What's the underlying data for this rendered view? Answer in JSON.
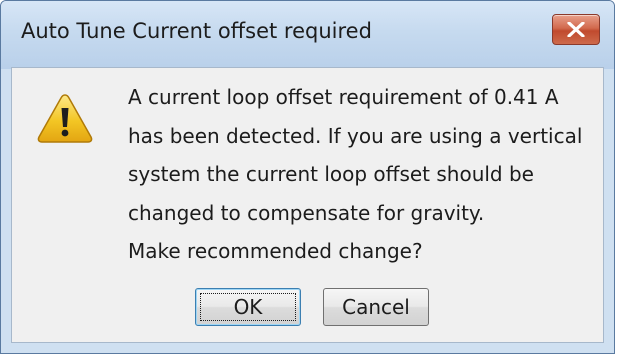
{
  "dialog": {
    "title": "Auto Tune Current offset required",
    "close_icon": "close-x-icon",
    "icon": "warning-icon",
    "message_lines": [
      "A current loop offset requirement of 0.41 A",
      "has been detected.  If you are using a vertical",
      "system the current loop offset should be",
      "changed to compensate for gravity.",
      "Make recommended change?"
    ],
    "ok_label": "OK",
    "cancel_label": "Cancel"
  },
  "colors": {
    "close_button": "#c75a3d",
    "warning_fill": "#f3c624",
    "titlebar": "#c6daef"
  }
}
